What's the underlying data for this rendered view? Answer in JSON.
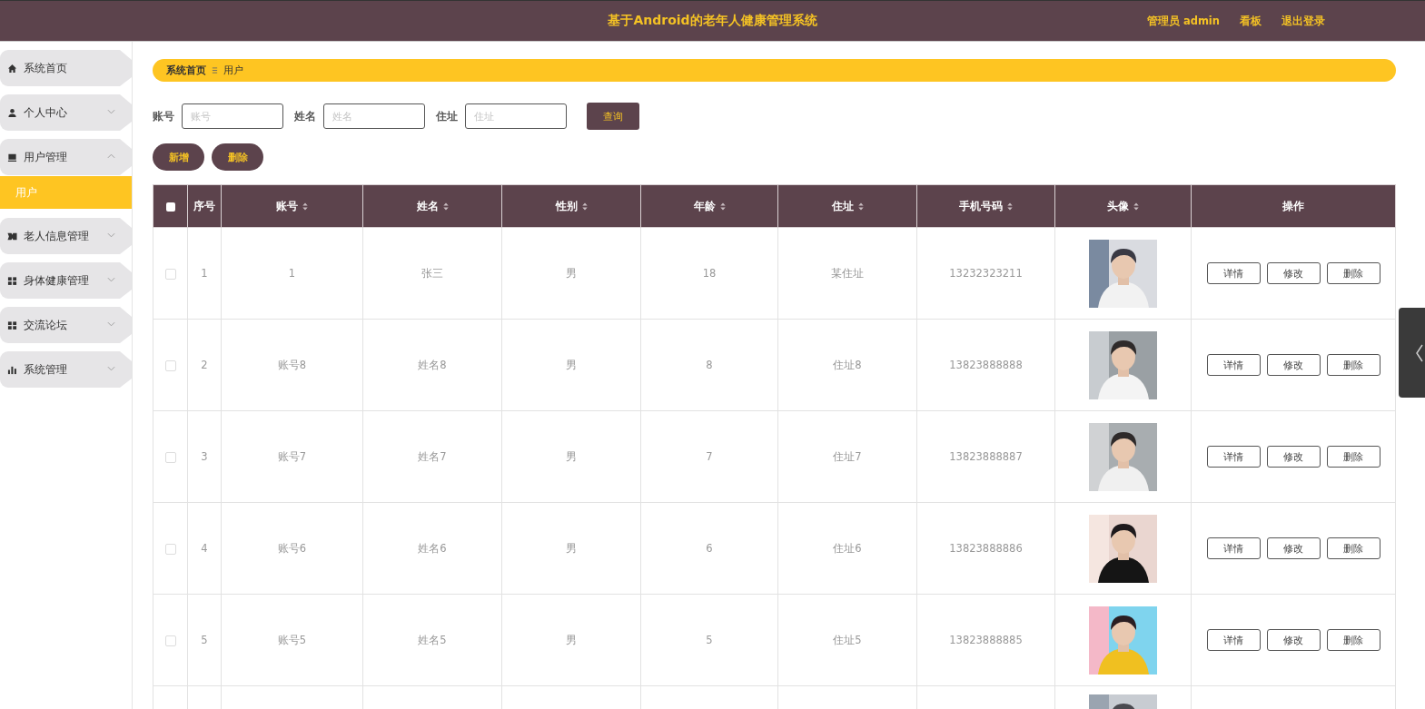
{
  "header": {
    "title": "基于Android的老年人健康管理系统",
    "user_label": "管理员 admin",
    "links": [
      "看板",
      "退出登录"
    ]
  },
  "sidebar": {
    "items": [
      {
        "label": "系统首页"
      },
      {
        "label": "个人中心",
        "expanded": false
      },
      {
        "label": "用户管理",
        "expanded": true,
        "children": [
          {
            "label": "用户",
            "selected": true
          }
        ]
      },
      {
        "label": "老人信息管理",
        "expanded": false
      },
      {
        "label": "身体健康管理",
        "expanded": false
      },
      {
        "label": "交流论坛",
        "expanded": false
      },
      {
        "label": "系统管理",
        "expanded": false
      }
    ]
  },
  "breadcrumb": [
    "系统首页",
    "用户"
  ],
  "search": {
    "fields": [
      {
        "label": "账号",
        "placeholder": "账号"
      },
      {
        "label": "姓名",
        "placeholder": "姓名"
      },
      {
        "label": "住址",
        "placeholder": "住址"
      }
    ],
    "button": "查询"
  },
  "actions": [
    "新增",
    "删除"
  ],
  "table": {
    "select_all": false,
    "columns": [
      {
        "label": "序号",
        "sortable": false
      },
      {
        "label": "账号",
        "sortable": true
      },
      {
        "label": "姓名",
        "sortable": true
      },
      {
        "label": "性别",
        "sortable": true
      },
      {
        "label": "年龄",
        "sortable": true
      },
      {
        "label": "住址",
        "sortable": true
      },
      {
        "label": "手机号码",
        "sortable": true
      },
      {
        "label": "头像",
        "sortable": true
      },
      {
        "label": "操作",
        "sortable": false
      }
    ],
    "rows": [
      {
        "checked": false,
        "cells": [
          "1",
          "1",
          "张三",
          "男",
          "18",
          "某住址",
          "13232323211"
        ],
        "avatar": {
          "kind": "picture"
        },
        "buttons": [
          "详情",
          "修改",
          "删除"
        ]
      },
      {
        "checked": false,
        "cells": [
          "2",
          "账号8",
          "姓名8",
          "男",
          "8",
          "住址8",
          "13823888888"
        ],
        "avatar": {
          "kind": "picture"
        },
        "buttons": [
          "详情",
          "修改",
          "删除"
        ]
      },
      {
        "checked": false,
        "cells": [
          "3",
          "账号7",
          "姓名7",
          "男",
          "7",
          "住址7",
          "13823888887"
        ],
        "avatar": {
          "kind": "picture"
        },
        "buttons": [
          "详情",
          "修改",
          "删除"
        ]
      },
      {
        "checked": false,
        "cells": [
          "4",
          "账号6",
          "姓名6",
          "男",
          "6",
          "住址6",
          "13823888886"
        ],
        "avatar": {
          "kind": "picture"
        },
        "buttons": [
          "详情",
          "修改",
          "删除"
        ]
      },
      {
        "checked": false,
        "cells": [
          "5",
          "账号5",
          "姓名5",
          "男",
          "5",
          "住址5",
          "13823888885"
        ],
        "avatar": {
          "kind": "picture"
        },
        "buttons": [
          "详情",
          "修改",
          "删除"
        ]
      },
      {
        "avatar": {
          "kind": "picture"
        }
      }
    ]
  }
}
